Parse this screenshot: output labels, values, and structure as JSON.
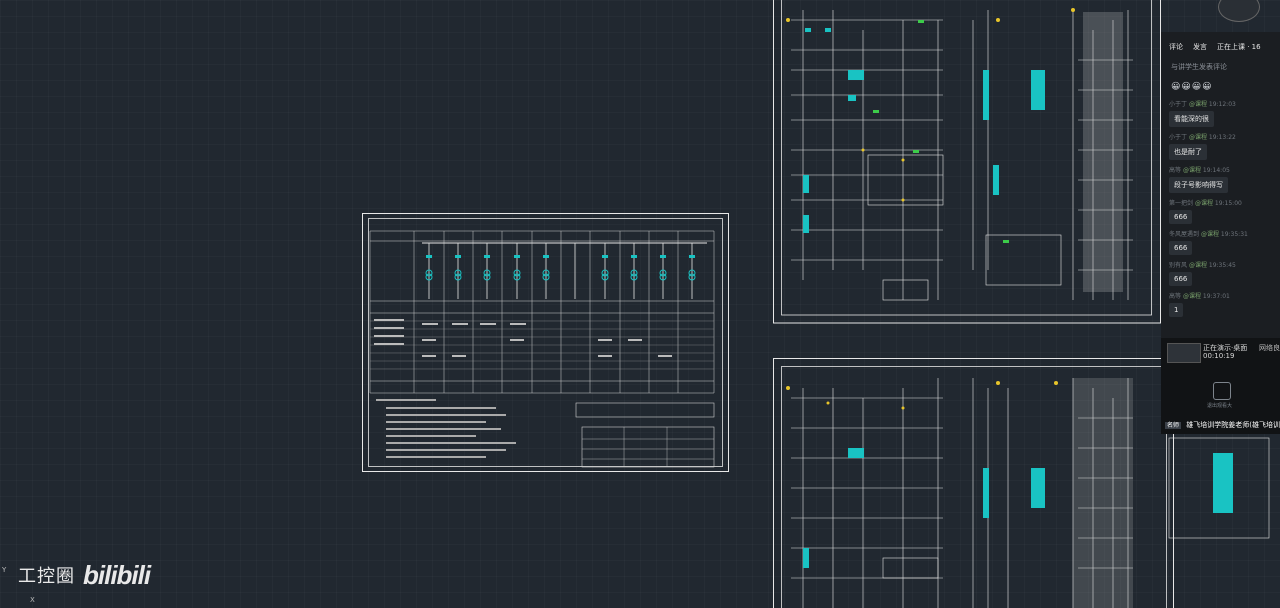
{
  "comments_panel": {
    "tabs": [
      "评论",
      "发言",
      "正在上课 · 16"
    ],
    "input_placeholder": "与讲学生发表评论",
    "emojis": "😀😀😀😀",
    "comments": [
      {
        "user": "小于丁",
        "badge": "@课程",
        "time": "19:12:03",
        "text": "看能深的很"
      },
      {
        "user": "小于丁",
        "badge": "@课程",
        "time": "19:13:22",
        "text": "也是耐了"
      },
      {
        "user": "高等",
        "badge": "@课程",
        "time": "19:14:05",
        "text": "段子号影响得写"
      },
      {
        "user": "第一把剑",
        "badge": "@课程",
        "time": "19:15:00",
        "text": "666"
      },
      {
        "user": "冬风屋遇到",
        "badge": "@课程",
        "time": "19:35:31",
        "text": "666"
      },
      {
        "user": "别有风",
        "badge": "@课程",
        "time": "19:35:45",
        "text": "666"
      },
      {
        "user": "高等",
        "badge": "@课程",
        "time": "19:37:01",
        "text": "1"
      }
    ]
  },
  "live_panel": {
    "status": "正在演示·桌面",
    "duration": "00:10:19",
    "network": "网络良",
    "qr_label": "退出观看大",
    "tag": "名师",
    "teacher": "雄飞培训学院姜老师(雄飞培训..."
  },
  "watermark": {
    "cn": "工控圈",
    "brand": "bilibili"
  },
  "corner_labels": {
    "y": "Y",
    "x": "X"
  }
}
